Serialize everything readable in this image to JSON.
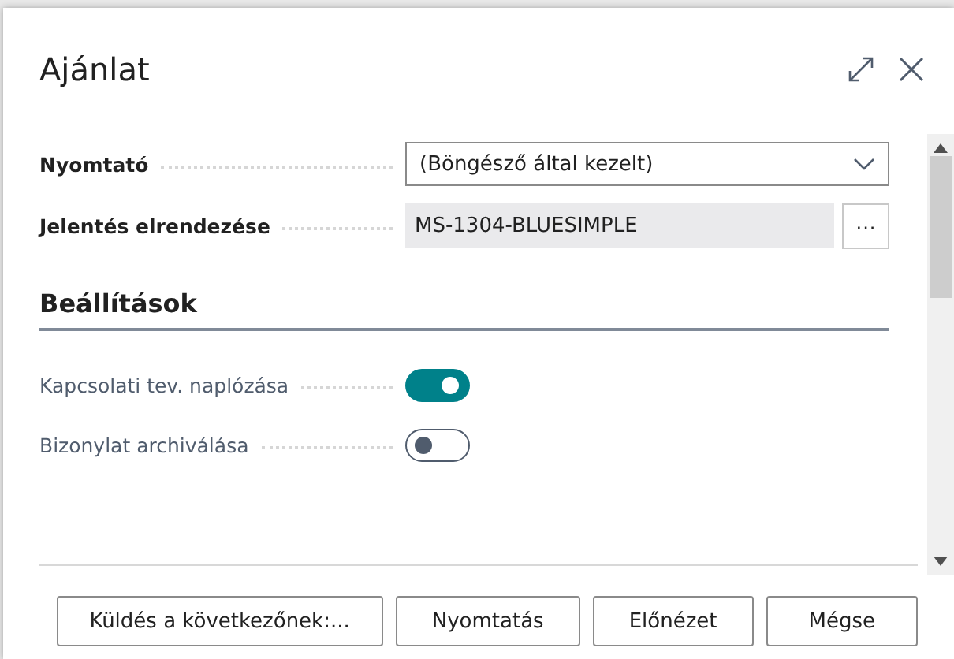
{
  "dialog": {
    "title": "Ajánlat"
  },
  "fields": [
    {
      "kind": "dropdown",
      "label": "Nyomtató",
      "value": "(Böngésző által kezelt)"
    },
    {
      "kind": "lookup",
      "label": "Jelentés elrendezése",
      "value": "MS-1304-BLUESIMPLE",
      "button": "···"
    }
  ],
  "section": {
    "title": "Beállítások",
    "options": [
      {
        "label": "Kapcsolati tev. naplózása",
        "on": true
      },
      {
        "label": "Bizonylat archiválása",
        "on": false
      }
    ]
  },
  "buttons": [
    "Küldés a következőnek:...",
    "Nyomtatás",
    "Előnézet",
    "Mégse"
  ]
}
